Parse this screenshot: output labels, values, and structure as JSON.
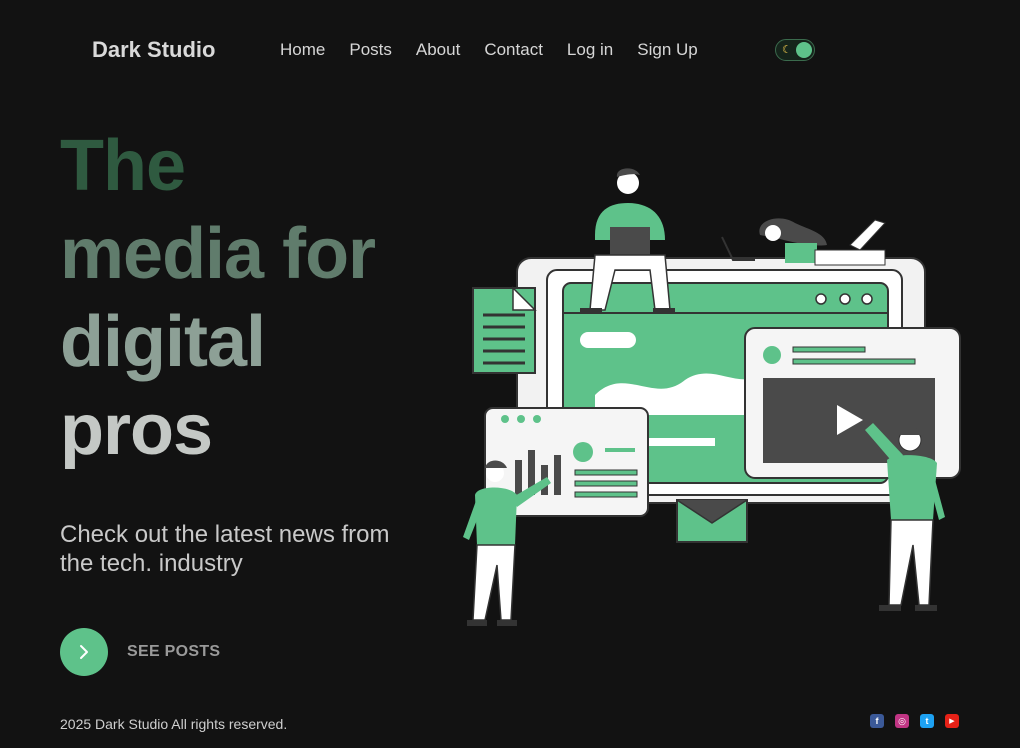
{
  "header": {
    "brand": "Dark Studio",
    "nav": [
      "Home",
      "Posts",
      "About",
      "Contact",
      "Log in",
      "Sign Up"
    ],
    "theme_toggle": {
      "icon": "moon-icon",
      "state": "dark"
    }
  },
  "hero": {
    "title_lines": [
      "The",
      "media for",
      "digital",
      "pros"
    ],
    "subtitle": "Check out the latest news from the tech. industry",
    "cta_label": "SEE POSTS",
    "cta_icon": "chevron-right-icon"
  },
  "footer": {
    "copyright": "2025 Dark Studio All rights reserved.",
    "social": [
      {
        "icon": "facebook-icon",
        "color": "#3b5998",
        "glyph": "f"
      },
      {
        "icon": "instagram-icon",
        "color": "#c13584",
        "glyph": "◎"
      },
      {
        "icon": "twitter-icon",
        "color": "#1da1f2",
        "glyph": "t"
      },
      {
        "icon": "youtube-icon",
        "color": "#e62117",
        "glyph": "▶"
      }
    ]
  },
  "colors": {
    "background": "#121212",
    "accent": "#5ec28a",
    "text": "#d6d6d6"
  }
}
